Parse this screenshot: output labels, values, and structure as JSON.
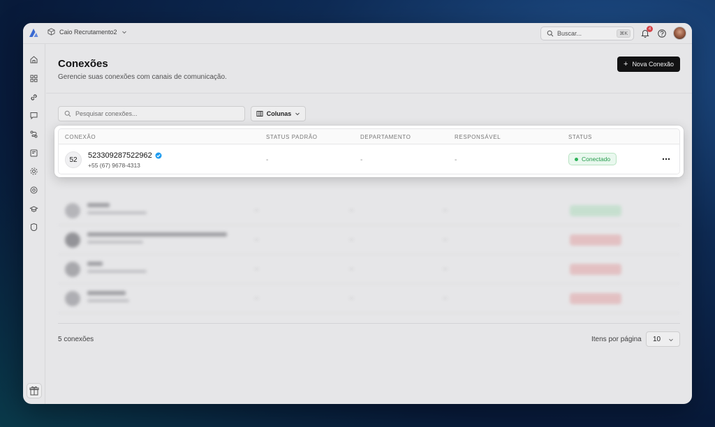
{
  "topbar": {
    "workspace_name": "Caio Recrutamento2",
    "search_placeholder": "Buscar...",
    "search_shortcut": "⌘K",
    "notification_count": "4"
  },
  "page": {
    "title": "Conexões",
    "subtitle": "Gerencie suas conexões com canais de comunicação.",
    "new_button_label": "Nova Conexão"
  },
  "filters": {
    "search_placeholder": "Pesquisar conexões...",
    "columns_label": "Colunas"
  },
  "table": {
    "headers": [
      "CONEXÃO",
      "STATUS PADRÃO",
      "DEPARTAMENTO",
      "RESPONSÁVEL",
      "STATUS"
    ],
    "highlighted_row": {
      "avatar_text": "52",
      "name": "523309287522962",
      "phone": "+55 (67) 9678-4313",
      "status_padrao": "-",
      "departamento": "-",
      "responsavel": "-",
      "status": "Conectado"
    }
  },
  "footer": {
    "count_label": "5 conexões",
    "per_page_label": "Itens por página",
    "per_page_value": "10"
  },
  "colors": {
    "primary": "#111111",
    "connected_green": "#239a4a",
    "disconnected_red": "#e5484d",
    "brand_blue": "#3b6fe0"
  }
}
